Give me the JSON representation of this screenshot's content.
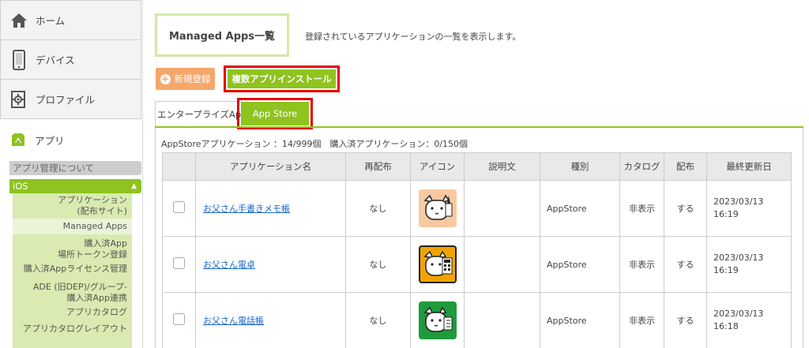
{
  "sidebar": {
    "home": "ホーム",
    "device": "デバイス",
    "profile": "プロファイル",
    "apps": "アプリ",
    "about": "アプリ管理について",
    "ios": "iOS",
    "submenu": [
      {
        "line1": "アプリケーション",
        "line2": "(配布サイト)"
      },
      {
        "line1": "Managed Apps",
        "line2": ""
      },
      {
        "line1": "購入済App",
        "line2": "場所トークン登録"
      },
      {
        "line1": "購入済Appライセンス管理",
        "line2": ""
      },
      {
        "line1": "ADE (旧DEP)/グループ-",
        "line2": "購入済App連携"
      },
      {
        "line1": "アプリカタログ",
        "line2": ""
      },
      {
        "line1": "アプリカタログレイアウト",
        "line2": ""
      }
    ]
  },
  "header": {
    "title": "Managed Apps一覧",
    "description": "登録されているアプリケーションの一覧を表示します。"
  },
  "buttons": {
    "new": "新規登録",
    "multi_install": "複数アプリインストール"
  },
  "tabs": {
    "enterprise": "エンタープライズApp",
    "appstore": "App Store"
  },
  "counts": "AppStoreアプリケーション ：14/999個　購入済アプリケーション：0/150個",
  "table": {
    "headers": [
      "",
      "アプリケーション名",
      "再配布",
      "アイコン",
      "説明文",
      "種別",
      "カタログ",
      "配布",
      "最終更新日"
    ],
    "rows": [
      {
        "name": "お父さん手書きメモ帳",
        "redistribute": "なし",
        "icon": "dog-memo-icon",
        "description": "",
        "kind": "AppStore",
        "catalog": "非表示",
        "distribute": "する",
        "date": "2023/03/13",
        "time": "16:19"
      },
      {
        "name": "お父さん電卓",
        "redistribute": "なし",
        "icon": "dog-calculator-icon",
        "description": "",
        "kind": "AppStore",
        "catalog": "非表示",
        "distribute": "する",
        "date": "2023/03/13",
        "time": "16:19"
      },
      {
        "name": "お父さん電話帳",
        "redistribute": "なし",
        "icon": "dog-phonebook-icon",
        "description": "",
        "kind": "AppStore",
        "catalog": "非表示",
        "distribute": "する",
        "date": "2023/03/13",
        "time": "16:18"
      }
    ]
  },
  "colors": {
    "accent_green": "#8fc31f",
    "highlight_red": "#e30000",
    "orange_button": "#f5a76b",
    "icon_bg_peach": "#f8c9a0",
    "icon_bg_orange": "#f0a400",
    "icon_bg_green": "#1f9a3c"
  }
}
